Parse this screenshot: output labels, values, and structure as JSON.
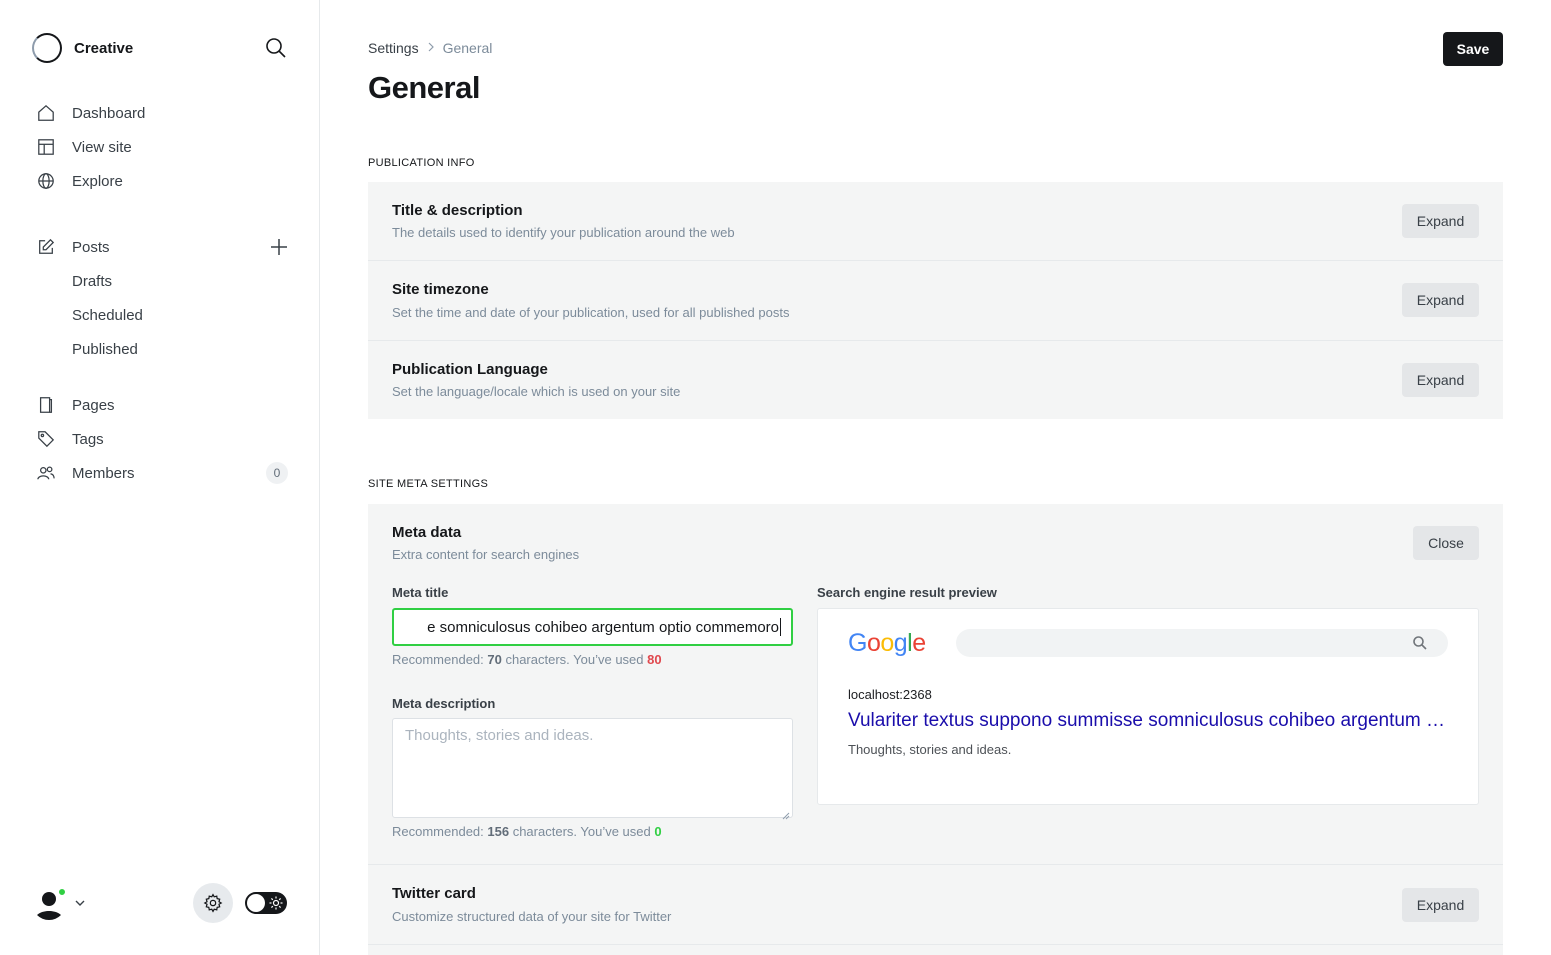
{
  "sidebar": {
    "brand": "Creative",
    "nav": {
      "dashboard": "Dashboard",
      "view_site": "View site",
      "explore": "Explore",
      "posts": "Posts",
      "drafts": "Drafts",
      "scheduled": "Scheduled",
      "published": "Published",
      "pages": "Pages",
      "tags": "Tags",
      "members": "Members",
      "members_count": "0"
    },
    "online_color": "#30cf43"
  },
  "header": {
    "breadcrumb_root": "Settings",
    "breadcrumb_current": "General",
    "title": "General",
    "save_label": "Save"
  },
  "publication_info": {
    "section_label": "PUBLICATION INFO",
    "rows": [
      {
        "title": "Title & description",
        "description": "The details used to identify your publication around the web",
        "action": "Expand"
      },
      {
        "title": "Site timezone",
        "description": "Set the time and date of your publication, used for all published posts",
        "action": "Expand"
      },
      {
        "title": "Publication Language",
        "description": "Set the language/locale which is used on your site",
        "action": "Expand"
      }
    ]
  },
  "site_meta": {
    "section_label": "SITE META SETTINGS",
    "meta_data": {
      "title": "Meta data",
      "description": "Extra content for search engines",
      "action": "Close",
      "meta_title_label": "Meta title",
      "meta_title_value": "e somniculosus cohibeo argentum optio commemoro",
      "meta_title_hint_prefix": "Recommended: ",
      "meta_title_hint_recommended": "70",
      "meta_title_hint_mid": " characters. You’ve used ",
      "meta_title_hint_used": "80",
      "meta_description_label": "Meta description",
      "meta_description_placeholder": "Thoughts, stories and ideas.",
      "meta_description_hint_prefix": "Recommended: ",
      "meta_description_hint_recommended": "156",
      "meta_description_hint_mid": " characters. You’ve used ",
      "meta_description_hint_used": "0",
      "preview_label": "Search engine result preview",
      "preview": {
        "logo": "Google",
        "url": "localhost:2368",
        "title": "Vulariter textus suppono summisse somniculosus cohibeo argentum optio commemoro",
        "description": "Thoughts, stories and ideas."
      }
    },
    "twitter": {
      "title": "Twitter card",
      "description": "Customize structured data of your site for Twitter",
      "action": "Expand"
    }
  },
  "colors": {
    "accent_dark": "#15171a",
    "input_focus": "#30cf43",
    "over_limit": "#e0484e",
    "serp_link": "#1a0dab"
  }
}
